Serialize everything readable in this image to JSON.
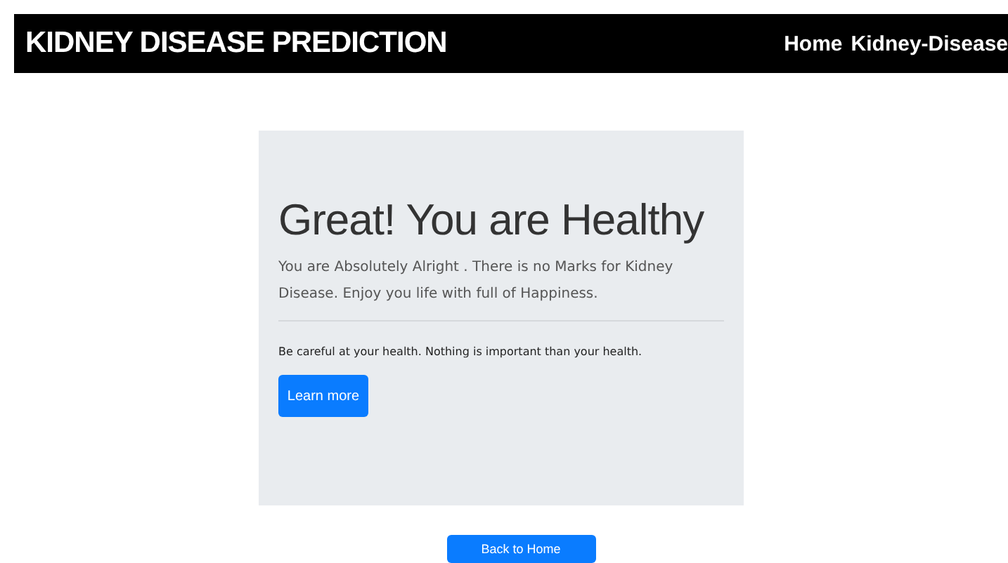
{
  "navbar": {
    "brand": "KIDNEY DISEASE PREDICTION",
    "links": [
      {
        "label": "Home"
      },
      {
        "label": "Kidney-Disease"
      }
    ]
  },
  "jumbotron": {
    "heading": "Great! You are Healthy",
    "lead": "You are Absolutely Alright . There is no Marks for Kidney Disease. Enjoy you life with full of Happiness.",
    "note": "Be careful at your health. Nothing is important than your health.",
    "button": "Learn more"
  },
  "back_button": "Back to Home"
}
